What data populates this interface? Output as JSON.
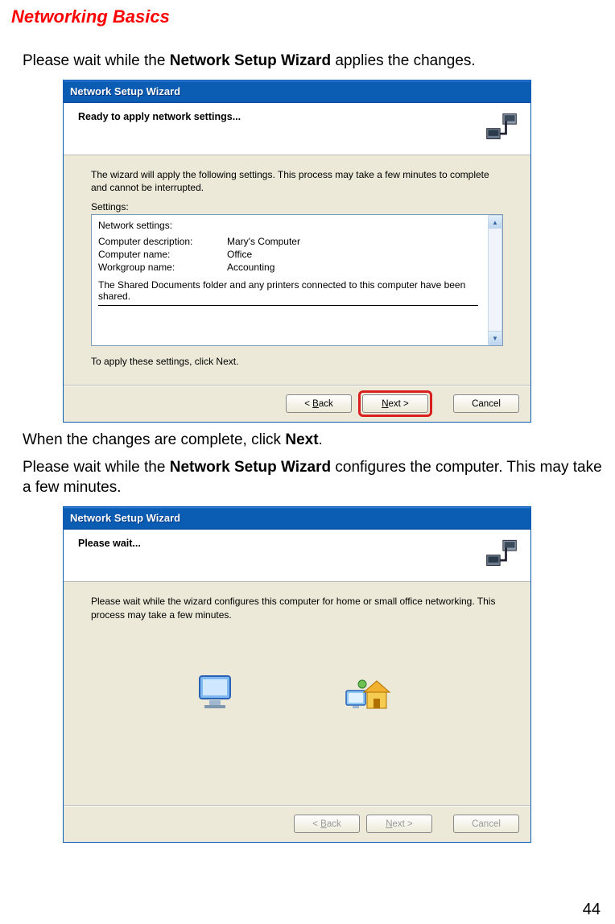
{
  "heading": "Networking Basics",
  "intro1_a": "Please wait while the ",
  "intro1_b": "Network Setup Wizard",
  "intro1_c": " applies the changes.",
  "intro2_a": "When the changes are complete, click ",
  "intro2_b": "Next",
  "intro2_c": ".",
  "intro3_a": "Please wait while the ",
  "intro3_b": "Network Setup Wizard",
  "intro3_c": " configures the computer. This may take a few minutes.",
  "page_number": "44",
  "wiz1": {
    "title": "Network Setup Wizard",
    "header": "Ready to apply network settings...",
    "desc": "The wizard will apply the following settings. This process may take a few minutes to complete and cannot be interrupted.",
    "settings_label": "Settings:",
    "box": {
      "line1": "Network settings:",
      "row1_k": "Computer description:",
      "row1_v": "Mary's Computer",
      "row2_k": "Computer name:",
      "row2_v": "Office",
      "row3_k": "Workgroup name:",
      "row3_v": "Accounting",
      "shared": "The Shared Documents folder and any printers connected to this computer have been shared."
    },
    "apply_line": "To apply these settings, click Next.",
    "back_label_pre": "< ",
    "back_label_u": "B",
    "back_label_post": "ack",
    "next_label_u": "N",
    "next_label_post": "ext >",
    "cancel_label": "Cancel"
  },
  "wiz2": {
    "title": "Network Setup Wizard",
    "header": "Please wait...",
    "desc": "Please wait while the wizard configures this computer for home or small office networking. This process may take a few minutes.",
    "back_label_pre": "< ",
    "back_label_u": "B",
    "back_label_post": "ack",
    "next_label_u": "N",
    "next_label_post": "ext >",
    "cancel_label": "Cancel"
  }
}
